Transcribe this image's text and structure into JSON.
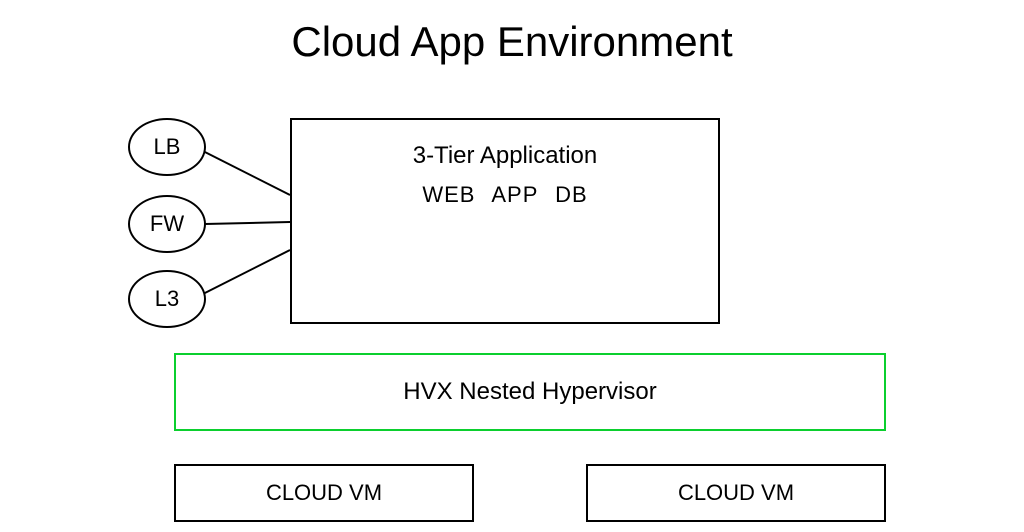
{
  "title": "Cloud App Environment",
  "nodes": {
    "lb": "LB",
    "fw": "FW",
    "l3": "L3"
  },
  "app_box": {
    "title": "3-Tier Application",
    "tiers": "WEB  APP  DB"
  },
  "hvx": "HVX Nested Hypervisor",
  "vm_left": "CLOUD VM",
  "vm_right": "CLOUD VM"
}
